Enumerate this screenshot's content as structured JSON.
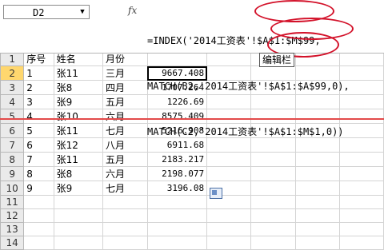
{
  "name_box": "D2",
  "fx_symbol": "fx",
  "formula_lines": [
    "=INDEX('2014工资表'!$A$1:$M$99,",
    "MATCH(B2,'2014工资表'!$A$1:$A$99,0),",
    "MATCH(C2,'2014工资表'!$A$1:$M$1,0))"
  ],
  "columns": [
    "A",
    "B",
    "C",
    "D"
  ],
  "rows": [
    {
      "n": "1",
      "a": "序号",
      "b": "姓名",
      "c": "月份",
      "d": ""
    },
    {
      "n": "2",
      "a": "1",
      "b": "张11",
      "c": "三月",
      "d": "9667.408"
    },
    {
      "n": "3",
      "a": "2",
      "b": "张8",
      "c": "四月",
      "d": "1707.264"
    },
    {
      "n": "4",
      "a": "3",
      "b": "张9",
      "c": "五月",
      "d": "1226.69"
    },
    {
      "n": "5",
      "a": "4",
      "b": "张10",
      "c": "六月",
      "d": "8575.409"
    },
    {
      "n": "6",
      "a": "5",
      "b": "张11",
      "c": "七月",
      "d": "5216.908"
    },
    {
      "n": "7",
      "a": "6",
      "b": "张12",
      "c": "八月",
      "d": "6911.68"
    },
    {
      "n": "8",
      "a": "7",
      "b": "张11",
      "c": "五月",
      "d": "2183.217"
    },
    {
      "n": "9",
      "a": "8",
      "b": "张8",
      "c": "六月",
      "d": "2198.077"
    },
    {
      "n": "10",
      "a": "9",
      "b": "张9",
      "c": "七月",
      "d": "3196.08"
    },
    {
      "n": "11",
      "a": "",
      "b": "",
      "c": "",
      "d": ""
    },
    {
      "n": "12",
      "a": "",
      "b": "",
      "c": "",
      "d": ""
    },
    {
      "n": "13",
      "a": "",
      "b": "",
      "c": "",
      "d": ""
    },
    {
      "n": "14",
      "a": "",
      "b": "",
      "c": "",
      "d": ""
    }
  ],
  "annotation_label": "编辑栏",
  "colors": {
    "annotation": "#d3122a",
    "strike_line": "#e34a4a",
    "active_header": "#ffd76e"
  }
}
